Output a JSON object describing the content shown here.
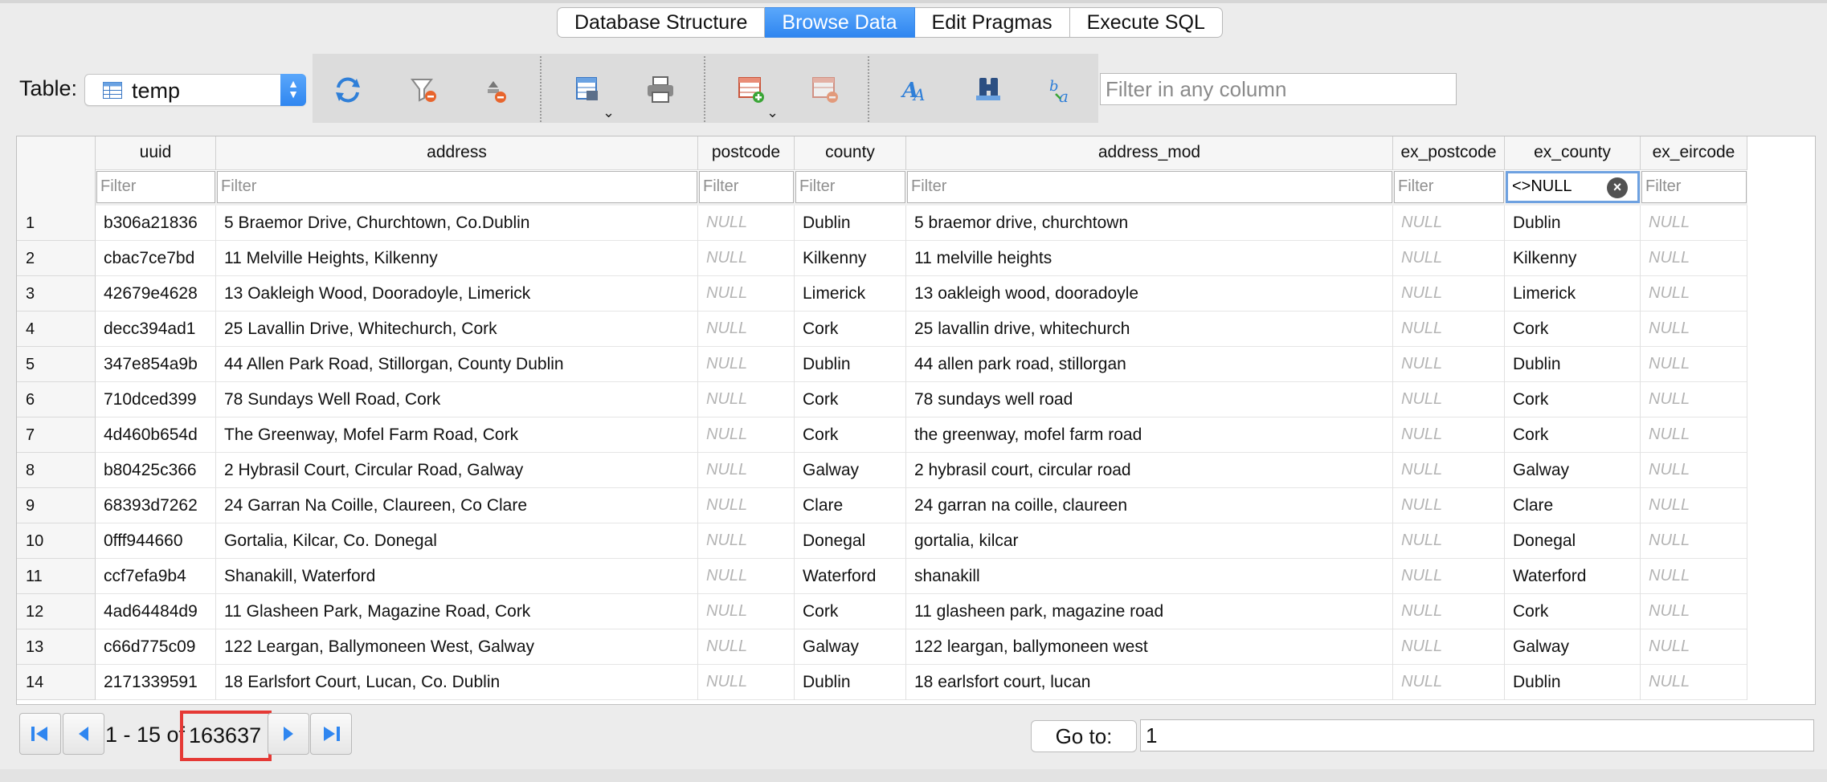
{
  "tabs": [
    {
      "label": "Database Structure",
      "active": false
    },
    {
      "label": "Browse Data",
      "active": true
    },
    {
      "label": "Edit Pragmas",
      "active": false
    },
    {
      "label": "Execute SQL",
      "active": false
    }
  ],
  "toolbar": {
    "table_label": "Table:",
    "table_value": "temp",
    "filter_placeholder": "Filter in any column",
    "icons": [
      "refresh-icon",
      "clear-filters-icon",
      "clear-sort-icon",
      "save-results-icon",
      "print-icon",
      "insert-record-icon",
      "delete-record-icon",
      "set-encoding-icon",
      "find-icon",
      "find-replace-icon"
    ]
  },
  "grid": {
    "columns": [
      "uuid",
      "address",
      "postcode",
      "county",
      "address_mod",
      "ex_postcode",
      "ex_county",
      "ex_eircode"
    ],
    "filter_placeholder": "Filter",
    "active_filter": {
      "column": "ex_county",
      "value": "<>NULL"
    },
    "null_label": "NULL",
    "rows": [
      {
        "num": "1",
        "uuid": "b306a21836",
        "address": "5 Braemor Drive, Churchtown, Co.Dublin",
        "county": "Dublin",
        "address_mod": "5 braemor drive, churchtown",
        "ex_county": "Dublin"
      },
      {
        "num": "2",
        "uuid": "cbac7ce7bd",
        "address": "11 Melville Heights, Kilkenny",
        "county": "Kilkenny",
        "address_mod": "11 melville heights",
        "ex_county": "Kilkenny"
      },
      {
        "num": "3",
        "uuid": "42679e4628",
        "address": "13  Oakleigh Wood, Dooradoyle, Limerick",
        "county": "Limerick",
        "address_mod": "13  oakleigh wood, dooradoyle",
        "ex_county": "Limerick"
      },
      {
        "num": "4",
        "uuid": "decc394ad1",
        "address": "25  Lavallin Drive, Whitechurch, Cork",
        "county": "Cork",
        "address_mod": "25  lavallin drive, whitechurch",
        "ex_county": "Cork"
      },
      {
        "num": "5",
        "uuid": "347e854a9b",
        "address": "44 Allen Park Road, Stillorgan, County Dublin",
        "county": "Dublin",
        "address_mod": "44 allen park road, stillorgan",
        "ex_county": "Dublin"
      },
      {
        "num": "6",
        "uuid": "710dced399",
        "address": "78 Sundays Well Road, Cork",
        "county": "Cork",
        "address_mod": "78 sundays well road",
        "ex_county": "Cork"
      },
      {
        "num": "7",
        "uuid": "4d460b654d",
        "address": "The Greenway, Mofel Farm Road, Cork",
        "county": "Cork",
        "address_mod": "the greenway, mofel farm road",
        "ex_county": "Cork"
      },
      {
        "num": "8",
        "uuid": "b80425c366",
        "address": "2 Hybrasil Court, Circular Road, Galway",
        "county": "Galway",
        "address_mod": "2 hybrasil court, circular road",
        "ex_county": "Galway"
      },
      {
        "num": "9",
        "uuid": "68393d7262",
        "address": "24 Garran Na Coille, Claureen, Co Clare",
        "county": "Clare",
        "address_mod": "24 garran na coille, claureen",
        "ex_county": "Clare"
      },
      {
        "num": "10",
        "uuid": "0fff944660",
        "address": "Gortalia, Kilcar, Co. Donegal",
        "county": "Donegal",
        "address_mod": "gortalia, kilcar",
        "ex_county": "Donegal"
      },
      {
        "num": "11",
        "uuid": "ccf7efa9b4",
        "address": "Shanakill, Waterford",
        "county": "Waterford",
        "address_mod": "shanakill",
        "ex_county": "Waterford"
      },
      {
        "num": "12",
        "uuid": "4ad64484d9",
        "address": "11 Glasheen Park, Magazine Road, Cork",
        "county": "Cork",
        "address_mod": "11 glasheen park, magazine road",
        "ex_county": "Cork"
      },
      {
        "num": "13",
        "uuid": "c66d775c09",
        "address": "122 Leargan, Ballymoneen West, Galway",
        "county": "Galway",
        "address_mod": "122 leargan, ballymoneen west",
        "ex_county": "Galway"
      },
      {
        "num": "14",
        "uuid": "2171339591",
        "address": "18 Earlsfort Court, Lucan, Co. Dublin",
        "county": "Dublin",
        "address_mod": "18 earlsfort court, lucan",
        "ex_county": "Dublin"
      }
    ]
  },
  "nav": {
    "range": "1 - 15 of",
    "total": "163637",
    "goto_label": "Go to:",
    "goto_value": "1",
    "highlight_color": "#e53935"
  },
  "colors": {
    "accent": "#2f86f0"
  }
}
